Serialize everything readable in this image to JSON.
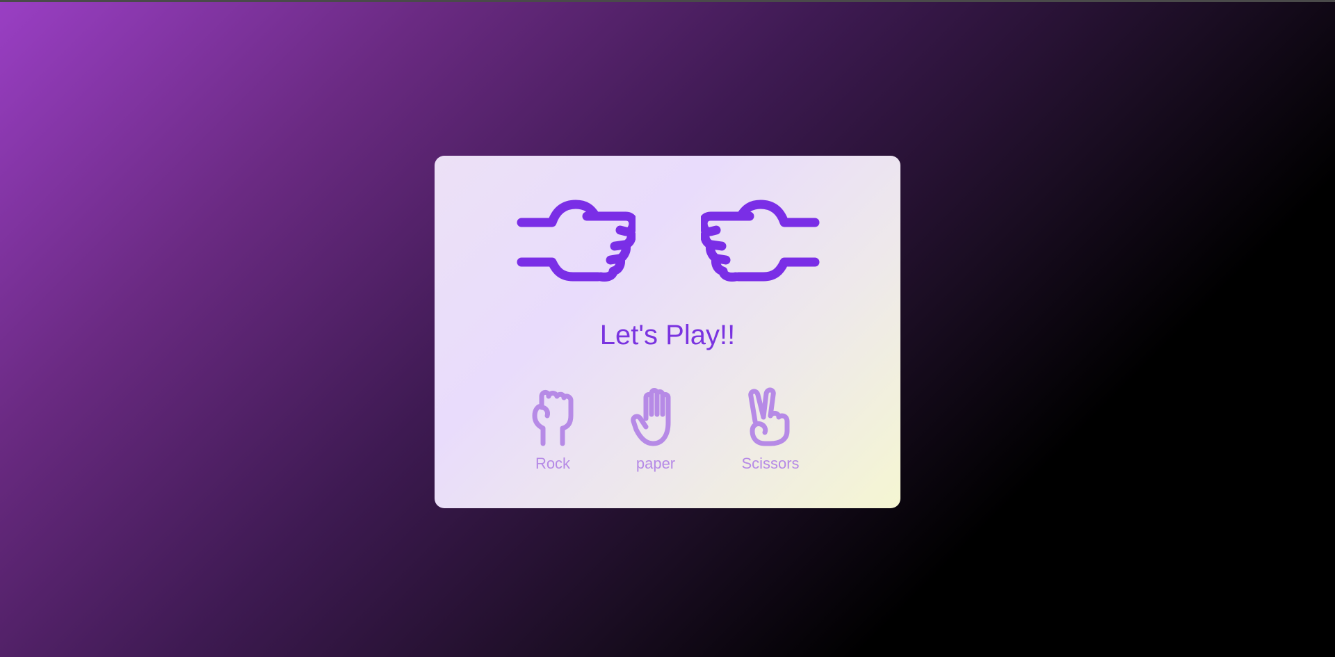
{
  "game": {
    "result_text": "Let's Play!!",
    "accent_color": "#7a33e0",
    "choice_color": "#b68ae6",
    "player_hand_icon": "fist-pointing-right-icon",
    "computer_hand_icon": "fist-pointing-left-icon"
  },
  "choices": [
    {
      "label": "Rock",
      "icon": "rock-fist-icon"
    },
    {
      "label": "paper",
      "icon": "paper-open-hand-icon"
    },
    {
      "label": "Scissors",
      "icon": "scissors-peace-hand-icon"
    }
  ]
}
